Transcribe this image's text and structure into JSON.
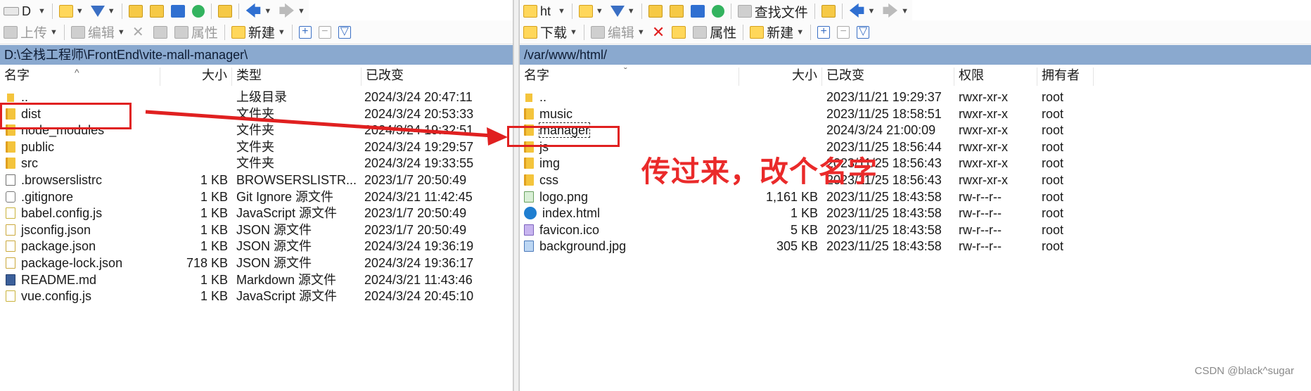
{
  "left_pane": {
    "toolbar1": {
      "drive_label": "D"
    },
    "toolbar2": {
      "upload": "上传",
      "edit": "编辑",
      "properties": "属性",
      "new": "新建"
    },
    "path": "D:\\全栈工程师\\FrontEnd\\vite-mall-manager\\",
    "columns": {
      "name": "名字",
      "size": "大小",
      "type": "类型",
      "modified": "已改变"
    },
    "rows": [
      {
        "name": "..",
        "size": "",
        "type": "上级目录",
        "modified": "2024/3/24  20:47:11",
        "icon": "up-folder-icon"
      },
      {
        "name": "dist",
        "size": "",
        "type": "文件夹",
        "modified": "2024/3/24  20:53:33",
        "icon": "folder-icon"
      },
      {
        "name": "node_modules",
        "size": "",
        "type": "文件夹",
        "modified": "2024/3/24  19:32:51",
        "icon": "folder-icon"
      },
      {
        "name": "public",
        "size": "",
        "type": "文件夹",
        "modified": "2024/3/24  19:29:57",
        "icon": "folder-icon"
      },
      {
        "name": "src",
        "size": "",
        "type": "文件夹",
        "modified": "2024/3/24  19:33:55",
        "icon": "folder-icon"
      },
      {
        "name": ".browserslistrc",
        "size": "1 KB",
        "type": "BROWSERSLISTR...",
        "modified": "2023/1/7  20:50:49",
        "icon": "document-icon"
      },
      {
        "name": ".gitignore",
        "size": "1 KB",
        "type": "Git Ignore 源文件",
        "modified": "2024/3/21  11:42:45",
        "icon": "gear-icon"
      },
      {
        "name": "babel.config.js",
        "size": "1 KB",
        "type": "JavaScript 源文件",
        "modified": "2023/1/7  20:50:49",
        "icon": "js-file-icon"
      },
      {
        "name": "jsconfig.json",
        "size": "1 KB",
        "type": "JSON 源文件",
        "modified": "2023/1/7  20:50:49",
        "icon": "json-file-icon"
      },
      {
        "name": "package.json",
        "size": "1 KB",
        "type": "JSON 源文件",
        "modified": "2024/3/24  19:36:19",
        "icon": "json-file-icon"
      },
      {
        "name": "package-lock.json",
        "size": "718 KB",
        "type": "JSON 源文件",
        "modified": "2024/3/24  19:36:17",
        "icon": "json-file-icon"
      },
      {
        "name": "README.md",
        "size": "1 KB",
        "type": "Markdown 源文件",
        "modified": "2024/3/21  11:43:46",
        "icon": "markdown-file-icon"
      },
      {
        "name": "vue.config.js",
        "size": "1 KB",
        "type": "JavaScript 源文件",
        "modified": "2024/3/24  20:45:10",
        "icon": "js-file-icon"
      }
    ]
  },
  "right_pane": {
    "toolbar1": {
      "drive_label": "ht",
      "find_files": "查找文件"
    },
    "toolbar2": {
      "download": "下载",
      "edit": "编辑",
      "properties": "属性",
      "new": "新建"
    },
    "path": "/var/www/html/",
    "columns": {
      "name": "名字",
      "size": "大小",
      "modified": "已改变",
      "permissions": "权限",
      "owner": "拥有者"
    },
    "rows": [
      {
        "name": "..",
        "size": "",
        "modified": "2023/11/21 19:29:37",
        "permissions": "rwxr-xr-x",
        "owner": "root",
        "icon": "up-folder-icon"
      },
      {
        "name": "music",
        "size": "",
        "modified": "2023/11/25 18:58:51",
        "permissions": "rwxr-xr-x",
        "owner": "root",
        "icon": "folder-icon"
      },
      {
        "name": "manager",
        "size": "",
        "modified": "2024/3/24 21:00:09",
        "permissions": "rwxr-xr-x",
        "owner": "root",
        "icon": "folder-icon"
      },
      {
        "name": "js",
        "size": "",
        "modified": "2023/11/25 18:56:44",
        "permissions": "rwxr-xr-x",
        "owner": "root",
        "icon": "folder-icon"
      },
      {
        "name": "img",
        "size": "",
        "modified": "2023/11/25 18:56:43",
        "permissions": "rwxr-xr-x",
        "owner": "root",
        "icon": "folder-icon"
      },
      {
        "name": "css",
        "size": "",
        "modified": "2023/11/25 18:56:43",
        "permissions": "rwxr-xr-x",
        "owner": "root",
        "icon": "folder-icon"
      },
      {
        "name": "logo.png",
        "size": "1,161 KB",
        "modified": "2023/11/25 18:43:58",
        "permissions": "rw-r--r--",
        "owner": "root",
        "icon": "png-file-icon"
      },
      {
        "name": "index.html",
        "size": "1 KB",
        "modified": "2023/11/25 18:43:58",
        "permissions": "rw-r--r--",
        "owner": "root",
        "icon": "edge-browser-icon"
      },
      {
        "name": "favicon.ico",
        "size": "5 KB",
        "modified": "2023/11/25 18:43:58",
        "permissions": "rw-r--r--",
        "owner": "root",
        "icon": "ico-file-icon"
      },
      {
        "name": "background.jpg",
        "size": "305 KB",
        "modified": "2023/11/25 18:43:58",
        "permissions": "rw-r--r--",
        "owner": "root",
        "icon": "jpg-file-icon"
      }
    ]
  },
  "annotation": {
    "text": "传过来，改个名字",
    "color": "#e02020"
  },
  "watermark": "CSDN @black^sugar",
  "colors": {
    "path_bar": "#8aa9cf",
    "annotation_red": "#e02020"
  }
}
